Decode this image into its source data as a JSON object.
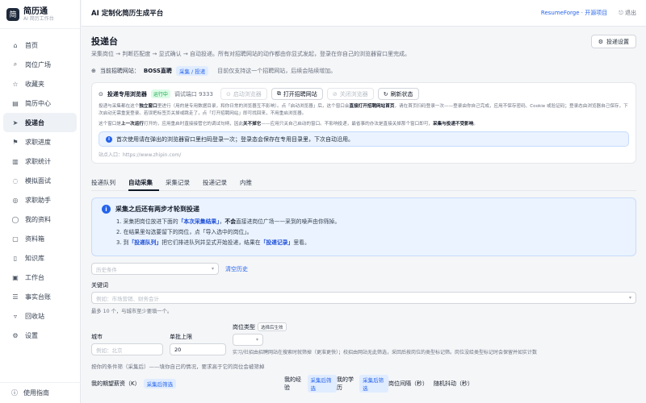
{
  "brand": {
    "name": "简历通",
    "subtitle": "AI 简历工作台",
    "logo_glyph": "简"
  },
  "sidebar": {
    "items": [
      {
        "label": "首页",
        "icon": "home-icon",
        "glyph": "⌂",
        "active": false
      },
      {
        "label": "岗位广场",
        "icon": "search-icon",
        "glyph": "⌕",
        "active": false
      },
      {
        "label": "收藏夹",
        "icon": "star-icon",
        "glyph": "☆",
        "active": false
      },
      {
        "label": "简历中心",
        "icon": "document-icon",
        "glyph": "▤",
        "active": false
      },
      {
        "label": "投递台",
        "icon": "send-icon",
        "glyph": "➤",
        "active": true
      },
      {
        "label": "求职进度",
        "icon": "flag-icon",
        "glyph": "⚑",
        "active": false
      },
      {
        "label": "求职统计",
        "icon": "chart-icon",
        "glyph": "▥",
        "active": false
      },
      {
        "label": "模拟面试",
        "icon": "chat-icon",
        "glyph": "◌",
        "active": false
      },
      {
        "label": "求职助手",
        "icon": "assistant-icon",
        "glyph": "◎",
        "active": false
      },
      {
        "label": "我的资料",
        "icon": "user-icon",
        "glyph": "◯",
        "active": false
      },
      {
        "label": "资料箱",
        "icon": "box-icon",
        "glyph": "▢",
        "active": false
      },
      {
        "label": "知识库",
        "icon": "book-icon",
        "glyph": "▯",
        "active": false
      },
      {
        "label": "工作台",
        "icon": "briefcase-icon",
        "glyph": "▣",
        "active": false
      },
      {
        "label": "事实台账",
        "icon": "ledger-icon",
        "glyph": "☰",
        "active": false
      },
      {
        "label": "回收站",
        "icon": "trash-icon",
        "glyph": "▿",
        "active": false
      },
      {
        "label": "设置",
        "icon": "gear-icon",
        "glyph": "⚙",
        "active": false
      }
    ],
    "guide_label": "使用指南",
    "guide_glyph": "ⓘ"
  },
  "topbar": {
    "title": "AI 定制化简历生成平台",
    "link": "ResumeForge · 开源项目",
    "logout": "退出",
    "logout_glyph": "⎋"
  },
  "page": {
    "title": "投递台",
    "description": "采集岗位 → 判断匹配度 → 显式确认 → 自动投递。所有对招聘网站的动作都由你显式发起，登录在你自己的浏览器窗口里完成。",
    "settings_button": "投递设置",
    "settings_glyph": "⚙"
  },
  "site": {
    "globe_glyph": "⊕",
    "label": "当前招聘网站：",
    "name": "BOSS直聘",
    "tag": "采集 / 投递",
    "note": "目前仅支持这一个招聘网站，后续会陆续增加。"
  },
  "browser": {
    "label": "投递专用浏览器",
    "status": "运行中",
    "port": "调试端口 9333",
    "buttons": [
      {
        "label": "启动浏览器",
        "glyph": "⊙",
        "disabled": true
      },
      {
        "label": "打开招聘网站",
        "glyph": "⧉",
        "disabled": false
      },
      {
        "label": "关闭浏览器",
        "glyph": "⊘",
        "disabled": true
      },
      {
        "label": "刷新状态",
        "glyph": "↻",
        "disabled": false
      }
    ],
    "para1_pre": "投递与采集都在这个",
    "para1_b1": "独立窗口",
    "para1_mid": "里进行（用的是专用数据目录，和你日常的浏览器互不影响）。点「启动浏览器」后，这个窗口会",
    "para1_b2": "直接打开招聘网站首页",
    "para1_post": "，请在首页扫码登录一次——登录由你自己完成，应用不保存密码、Cookie 或验证码；登录态由浏览器自己保存，下次启动无需重复登录。若误把标签页关掉或跳走了，点「打开招聘网站」即可找回来，不用重启浏览器。",
    "para2_pre": "这个窗口是",
    "para2_b1": "上一次运行",
    "para2_mid": "打开的，应用重启时直接接管它的调试句柄，因此",
    "para2_b2": "关不掉它",
    "para2_mid2": "——应用只关自己启动的窗口。不影响投递，最省事的办法是直接关掉那个窗口即可，",
    "para2_b3": "采集与投递不受影响",
    "para2_post": "。",
    "info": "首次使用请在弹出的浏览器窗口里扫码登录一次；登录态会保存在专用目录里，下次自动沿用。",
    "url_line": "站点入口：https://www.zhipin.com/"
  },
  "tabs": [
    {
      "label": "投递队列",
      "active": false
    },
    {
      "label": "自动采集",
      "active": true
    },
    {
      "label": "采集记录",
      "active": false
    },
    {
      "label": "投递记录",
      "active": false
    },
    {
      "label": "内推",
      "active": false
    }
  ],
  "notice": {
    "title": "采集之后还有两步才轮到投递",
    "step1_pre": "1. 采集把岗位放进下面的",
    "step1_b1": "「本次采集结果」",
    "step1_mid": "，",
    "step1_b2": "不会",
    "step1_post": "直接进岗位广场——采到的噪声由你筛掉。",
    "step2": "2. 在结果里勾选要留下的岗位，点「导入选中的岗位」。",
    "step3_pre": "3. 到",
    "step3_b1": "「投递队列」",
    "step3_mid": "把它们排进队列并显式开始投递，结果在",
    "step3_b2": "「投递记录」",
    "step3_post": "里看。"
  },
  "form": {
    "history_placeholder": "历史条件",
    "clear_history": "清空历史",
    "keyword_label": "关键词",
    "keyword_placeholder": "例如：市场营销、财务会计",
    "keyword_hint": "最多 10 个，与城市至少要填一个。",
    "city_label": "城市",
    "city_placeholder": "例如：北京",
    "per_keyword_label": "单批上限",
    "per_keyword_value": "20",
    "job_type_label": "岗位类型",
    "job_type_button": "选择后生效",
    "job_type_hint": "实习/社招由招聘网站在搜索时就筛掉（更准更快）；校招由网站无此筛选，采回后按岗位的类型标记筛。岗位没给类型标记时会保留并如实计数",
    "cond_hint": "按你的条件筛（采集后）——填你自己的情况，要求高于它的岗位会被筛掉",
    "bottom_labels": [
      {
        "label": "我的期望薪资（K）",
        "tag": "采集后筛选"
      },
      {
        "label": "我的经验",
        "tag": "采集后筛选"
      },
      {
        "label": "我的学历",
        "tag": "采集后筛选"
      },
      {
        "label": "岗位间隔（秒）",
        "tag": ""
      },
      {
        "label": "随机抖动（秒）",
        "tag": ""
      }
    ]
  },
  "colors": {
    "accent": "#2563eb",
    "info_bg": "#eaf3ff",
    "success": "#16a34a"
  }
}
